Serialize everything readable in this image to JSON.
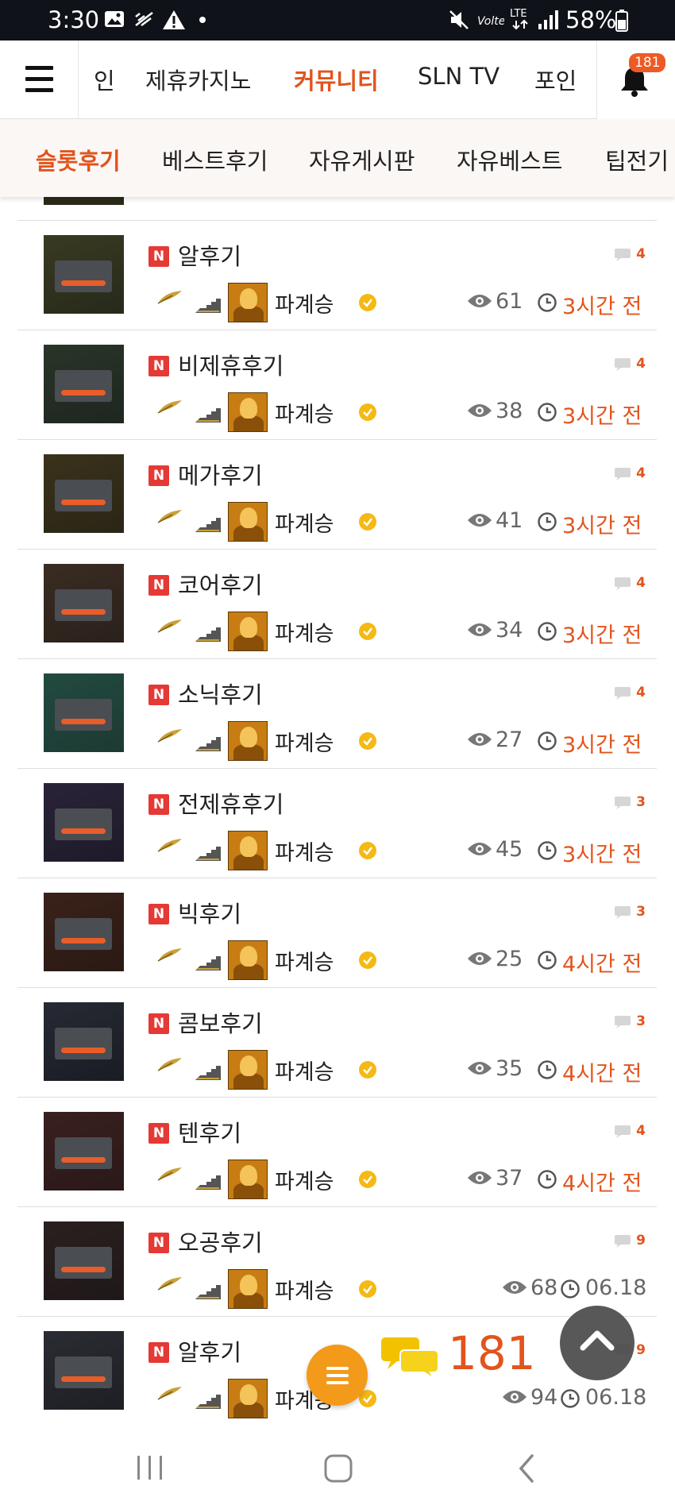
{
  "status_bar": {
    "time": "3:30",
    "battery": "58%",
    "network": "LTE"
  },
  "top_nav": {
    "items": [
      "인",
      "제휴카지노",
      "커뮤니티",
      "SLN TV",
      "포인"
    ],
    "active": "커뮤니티",
    "notification_count": "181"
  },
  "sub_nav": {
    "items": [
      "슬롯후기",
      "베스트후기",
      "자유게시판",
      "자유베스트",
      "팁전기"
    ],
    "active": "슬롯후기"
  },
  "posts": [
    {
      "badge": "N",
      "title": "알후기",
      "author": "파계승",
      "views": "61",
      "time": "3시간 전",
      "comments": "4"
    },
    {
      "badge": "N",
      "title": "비제휴후기",
      "author": "파계승",
      "views": "38",
      "time": "3시간 전",
      "comments": "4"
    },
    {
      "badge": "N",
      "title": "메가후기",
      "author": "파계승",
      "views": "41",
      "time": "3시간 전",
      "comments": "4"
    },
    {
      "badge": "N",
      "title": "코어후기",
      "author": "파계승",
      "views": "34",
      "time": "3시간 전",
      "comments": "4"
    },
    {
      "badge": "N",
      "title": "소닉후기",
      "author": "파계승",
      "views": "27",
      "time": "3시간 전",
      "comments": "4"
    },
    {
      "badge": "N",
      "title": "전제휴후기",
      "author": "파계승",
      "views": "45",
      "time": "3시간 전",
      "comments": "3"
    },
    {
      "badge": "N",
      "title": "빅후기",
      "author": "파계승",
      "views": "25",
      "time": "4시간 전",
      "comments": "3"
    },
    {
      "badge": "N",
      "title": "콤보후기",
      "author": "파계승",
      "views": "35",
      "time": "4시간 전",
      "comments": "3"
    },
    {
      "badge": "N",
      "title": "텐후기",
      "author": "파계승",
      "views": "37",
      "time": "4시간 전",
      "comments": "4"
    },
    {
      "badge": "N",
      "title": "오공후기",
      "author": "파계승",
      "views": "68",
      "time": "06.18",
      "comments": "9"
    },
    {
      "badge": "N",
      "title": "알후기",
      "author": "파계승",
      "views": "94",
      "time": "06.18",
      "comments": "9"
    }
  ],
  "floating": {
    "chat_count": "181"
  },
  "colors": {
    "accent": "#e2541c",
    "new_badge": "#e53935",
    "fab": "#f39a1a"
  }
}
